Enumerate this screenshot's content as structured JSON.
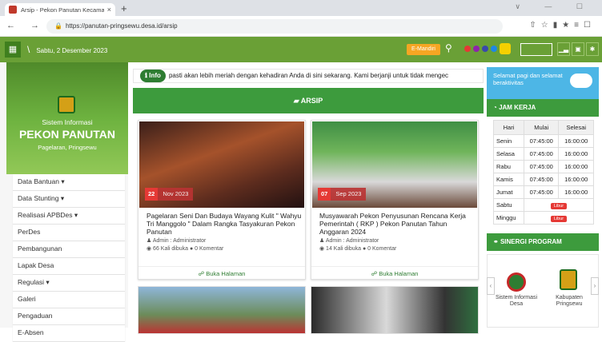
{
  "browser": {
    "tab_title": "Arsip - Pekon Panutan Kecamat",
    "tab_close": "×",
    "new_tab": "+",
    "url": "https://panutan-pringsewu.desa.id/arsip",
    "window_controls": "∨ — ☐",
    "nav": "← → C"
  },
  "topbar": {
    "date": "Sabtu, 2 Desember 2023",
    "emandiri": "E-Mandiri",
    "dot_colors": [
      "#e53935",
      "#8e24aa",
      "#3949ab",
      "#1e88e5"
    ]
  },
  "sidebar": {
    "banner_sub": "Sistem Informasi",
    "banner_title": "PEKON PANUTAN",
    "banner_loc": "Pagelaran, Pringsewu",
    "menu": [
      "Data Bantuan ▾",
      "Data Stunting ▾",
      "Realisasi APBDes ▾",
      "PerDes",
      "Pembangunan",
      "Lapak Desa",
      "Regulasi ▾",
      "Galeri",
      "Pengaduan",
      "E-Absen"
    ]
  },
  "main": {
    "info_label": "Info",
    "ticker": "pasti akan lebih meriah dengan kehadiran Anda di sini sekarang. Kami berjanji untuk tidak mengec",
    "arsip_title": "ARSIP",
    "cards": [
      {
        "day": "22",
        "month": "Nov 2023",
        "title": "Pagelaran Seni Dan Budaya Wayang Kulit \" Wahyu Tri Manggolo \" Dalam Rangka Tasyakuran Pekon Panutan",
        "author": "♟ Admin : Administrator",
        "stats": "◉ 66 Kali dibuka  ● 0 Komentar",
        "button": "☍ Buka Halaman"
      },
      {
        "day": "07",
        "month": "Sep 2023",
        "title": "Musyawarah Pekon Penyusunan Rencana Kerja Pemerintah ( RKP ) Pekon Panutan Tahun Anggaran 2024",
        "author": "♟ Admin : Administrator",
        "stats": "◉ 14 Kali dibuka  ● 0 Komentar",
        "button": "☍ Buka Halaman"
      }
    ]
  },
  "right": {
    "greeting": "Selamat pagi dan selamat beraktivitas",
    "jam_title": "JAM KERJA",
    "jam_headers": [
      "Hari",
      "Mulai",
      "Selesai"
    ],
    "jam_rows": [
      [
        "Senin",
        "07:45:00",
        "16:00:00"
      ],
      [
        "Selasa",
        "07:45:00",
        "16:00:00"
      ],
      [
        "Rabu",
        "07:45:00",
        "16:00:00"
      ],
      [
        "Kamis",
        "07:45:00",
        "16:00:00"
      ],
      [
        "Jumat",
        "07:45:00",
        "16:00:00"
      ]
    ],
    "libur_rows": [
      "Sabtu",
      "Minggu"
    ],
    "libur_label": "Libur",
    "sinergi_title": "SINERGI PROGRAM",
    "sinergi_items": [
      "Sistem Informasi Desa",
      "Kabupaten Pringsewu"
    ]
  }
}
